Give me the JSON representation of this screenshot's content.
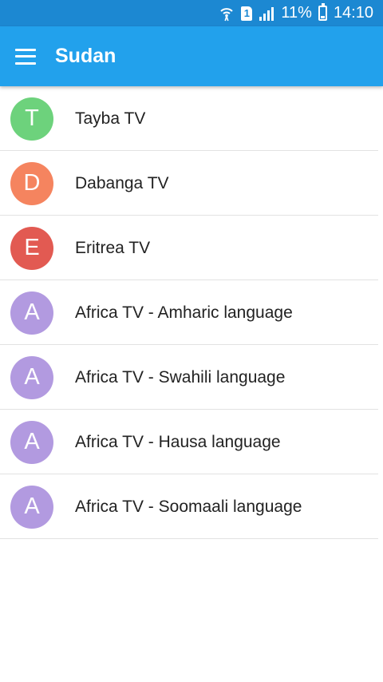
{
  "status_bar": {
    "sim_label": "1",
    "battery_percent": "11%",
    "time": "14:10"
  },
  "app_bar": {
    "title": "Sudan",
    "menu_icon": "hamburger-menu-icon"
  },
  "channels": [
    {
      "letter": "T",
      "name": "Tayba TV",
      "avatar_color": "#6dd27c"
    },
    {
      "letter": "D",
      "name": "Dabanga TV",
      "avatar_color": "#f5845f"
    },
    {
      "letter": "E",
      "name": "Eritrea TV",
      "avatar_color": "#e25a52"
    },
    {
      "letter": "A",
      "name": "Africa TV - Amharic language",
      "avatar_color": "#b29ae0"
    },
    {
      "letter": "A",
      "name": "Africa TV - Swahili language",
      "avatar_color": "#b29ae0"
    },
    {
      "letter": "A",
      "name": "Africa TV - Hausa language",
      "avatar_color": "#b29ae0"
    },
    {
      "letter": "A",
      "name": "Africa TV - Soomaali language",
      "avatar_color": "#b29ae0"
    }
  ]
}
